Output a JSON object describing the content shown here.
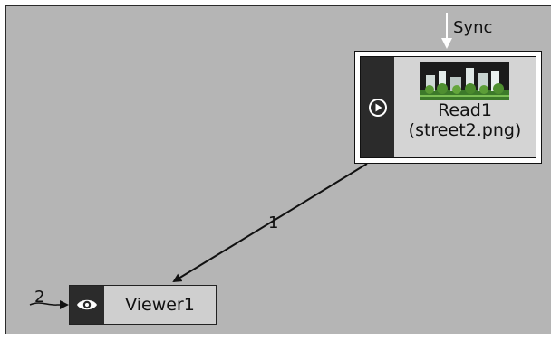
{
  "graph": {
    "read_node": {
      "title": "Read1",
      "subtitle": "(street2.png)",
      "icon": "play-circle-icon",
      "thumbnail": "street-thumbnail"
    },
    "viewer_node": {
      "title": "Viewer1",
      "icon": "eye-icon"
    },
    "edges": {
      "sync_label": "Sync",
      "edge_1_label": "1",
      "edge_2_label": "2"
    }
  },
  "colors": {
    "canvas_bg": "#b5b5b5",
    "node_bg": "#d4d4d4",
    "icon_cell_bg": "#2b2b2b",
    "edge": "#111111"
  }
}
